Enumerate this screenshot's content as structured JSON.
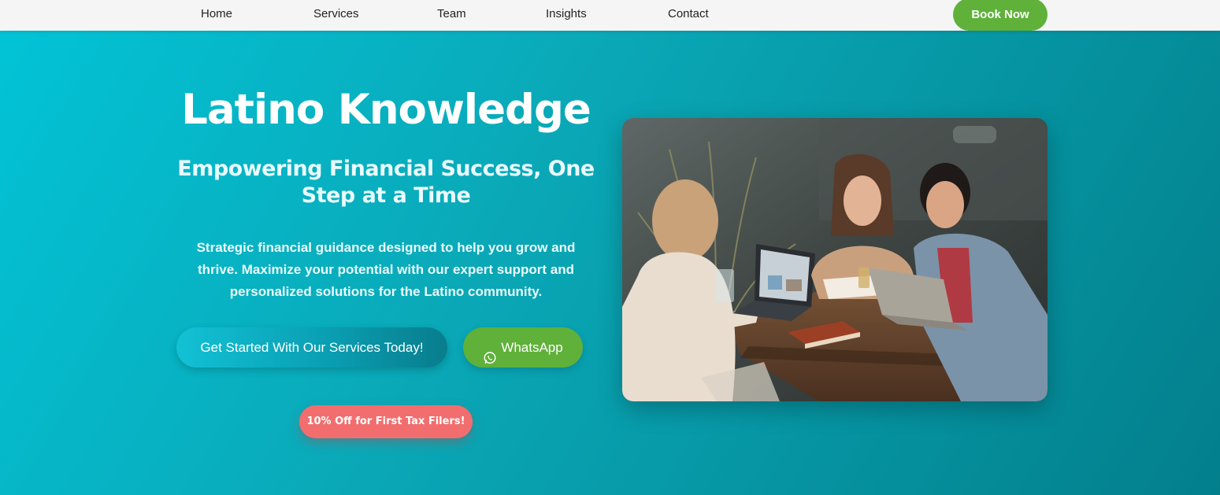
{
  "nav": {
    "items": [
      {
        "label": "Home"
      },
      {
        "label": "Services"
      },
      {
        "label": "Team"
      },
      {
        "label": "Insights"
      },
      {
        "label": "Contact"
      }
    ],
    "book_label": "Book Now"
  },
  "hero": {
    "title": "Latino Knowledge",
    "subtitle": "Empowering Financial Success, One Step at a Time",
    "description": "Strategic financial guidance designed to help you grow and thrive. Maximize your potential with our expert support and personalized solutions for the Latino community.",
    "cta_label": "Get Started With Our Services Today!",
    "whatsapp_label": "WhatsApp",
    "whatsapp_icon": "whatsapp-icon",
    "promo_label": "10% Off for First Tax Filers!"
  },
  "colors": {
    "brand_green": "#5fb13a",
    "promo_red": "#f26e6e",
    "hero_teal": "#02c3d6"
  }
}
